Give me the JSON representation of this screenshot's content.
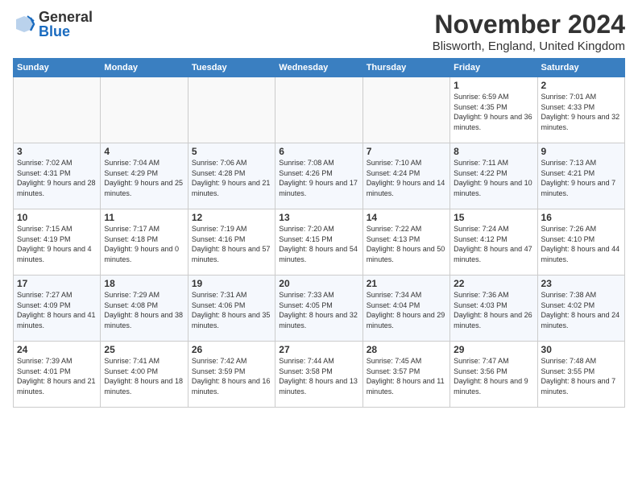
{
  "logo": {
    "general": "General",
    "blue": "Blue"
  },
  "title": "November 2024",
  "location": "Blisworth, England, United Kingdom",
  "days_of_week": [
    "Sunday",
    "Monday",
    "Tuesday",
    "Wednesday",
    "Thursday",
    "Friday",
    "Saturday"
  ],
  "weeks": [
    [
      {
        "day": "",
        "info": ""
      },
      {
        "day": "",
        "info": ""
      },
      {
        "day": "",
        "info": ""
      },
      {
        "day": "",
        "info": ""
      },
      {
        "day": "",
        "info": ""
      },
      {
        "day": "1",
        "info": "Sunrise: 6:59 AM\nSunset: 4:35 PM\nDaylight: 9 hours\nand 36 minutes."
      },
      {
        "day": "2",
        "info": "Sunrise: 7:01 AM\nSunset: 4:33 PM\nDaylight: 9 hours\nand 32 minutes."
      }
    ],
    [
      {
        "day": "3",
        "info": "Sunrise: 7:02 AM\nSunset: 4:31 PM\nDaylight: 9 hours\nand 28 minutes."
      },
      {
        "day": "4",
        "info": "Sunrise: 7:04 AM\nSunset: 4:29 PM\nDaylight: 9 hours\nand 25 minutes."
      },
      {
        "day": "5",
        "info": "Sunrise: 7:06 AM\nSunset: 4:28 PM\nDaylight: 9 hours\nand 21 minutes."
      },
      {
        "day": "6",
        "info": "Sunrise: 7:08 AM\nSunset: 4:26 PM\nDaylight: 9 hours\nand 17 minutes."
      },
      {
        "day": "7",
        "info": "Sunrise: 7:10 AM\nSunset: 4:24 PM\nDaylight: 9 hours\nand 14 minutes."
      },
      {
        "day": "8",
        "info": "Sunrise: 7:11 AM\nSunset: 4:22 PM\nDaylight: 9 hours\nand 10 minutes."
      },
      {
        "day": "9",
        "info": "Sunrise: 7:13 AM\nSunset: 4:21 PM\nDaylight: 9 hours\nand 7 minutes."
      }
    ],
    [
      {
        "day": "10",
        "info": "Sunrise: 7:15 AM\nSunset: 4:19 PM\nDaylight: 9 hours\nand 4 minutes."
      },
      {
        "day": "11",
        "info": "Sunrise: 7:17 AM\nSunset: 4:18 PM\nDaylight: 9 hours\nand 0 minutes."
      },
      {
        "day": "12",
        "info": "Sunrise: 7:19 AM\nSunset: 4:16 PM\nDaylight: 8 hours\nand 57 minutes."
      },
      {
        "day": "13",
        "info": "Sunrise: 7:20 AM\nSunset: 4:15 PM\nDaylight: 8 hours\nand 54 minutes."
      },
      {
        "day": "14",
        "info": "Sunrise: 7:22 AM\nSunset: 4:13 PM\nDaylight: 8 hours\nand 50 minutes."
      },
      {
        "day": "15",
        "info": "Sunrise: 7:24 AM\nSunset: 4:12 PM\nDaylight: 8 hours\nand 47 minutes."
      },
      {
        "day": "16",
        "info": "Sunrise: 7:26 AM\nSunset: 4:10 PM\nDaylight: 8 hours\nand 44 minutes."
      }
    ],
    [
      {
        "day": "17",
        "info": "Sunrise: 7:27 AM\nSunset: 4:09 PM\nDaylight: 8 hours\nand 41 minutes."
      },
      {
        "day": "18",
        "info": "Sunrise: 7:29 AM\nSunset: 4:08 PM\nDaylight: 8 hours\nand 38 minutes."
      },
      {
        "day": "19",
        "info": "Sunrise: 7:31 AM\nSunset: 4:06 PM\nDaylight: 8 hours\nand 35 minutes."
      },
      {
        "day": "20",
        "info": "Sunrise: 7:33 AM\nSunset: 4:05 PM\nDaylight: 8 hours\nand 32 minutes."
      },
      {
        "day": "21",
        "info": "Sunrise: 7:34 AM\nSunset: 4:04 PM\nDaylight: 8 hours\nand 29 minutes."
      },
      {
        "day": "22",
        "info": "Sunrise: 7:36 AM\nSunset: 4:03 PM\nDaylight: 8 hours\nand 26 minutes."
      },
      {
        "day": "23",
        "info": "Sunrise: 7:38 AM\nSunset: 4:02 PM\nDaylight: 8 hours\nand 24 minutes."
      }
    ],
    [
      {
        "day": "24",
        "info": "Sunrise: 7:39 AM\nSunset: 4:01 PM\nDaylight: 8 hours\nand 21 minutes."
      },
      {
        "day": "25",
        "info": "Sunrise: 7:41 AM\nSunset: 4:00 PM\nDaylight: 8 hours\nand 18 minutes."
      },
      {
        "day": "26",
        "info": "Sunrise: 7:42 AM\nSunset: 3:59 PM\nDaylight: 8 hours\nand 16 minutes."
      },
      {
        "day": "27",
        "info": "Sunrise: 7:44 AM\nSunset: 3:58 PM\nDaylight: 8 hours\nand 13 minutes."
      },
      {
        "day": "28",
        "info": "Sunrise: 7:45 AM\nSunset: 3:57 PM\nDaylight: 8 hours\nand 11 minutes."
      },
      {
        "day": "29",
        "info": "Sunrise: 7:47 AM\nSunset: 3:56 PM\nDaylight: 8 hours\nand 9 minutes."
      },
      {
        "day": "30",
        "info": "Sunrise: 7:48 AM\nSunset: 3:55 PM\nDaylight: 8 hours\nand 7 minutes."
      }
    ]
  ]
}
